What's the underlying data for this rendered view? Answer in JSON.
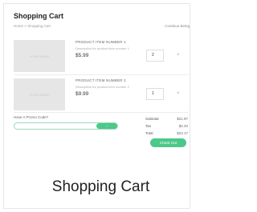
{
  "cart": {
    "title": "Shopping Cart",
    "breadcrumb": "Home > Shopping Cart",
    "continue_label": "Continue Being",
    "items": [
      {
        "name": "PRODUCT ITEM NUMBER 1",
        "description": "Description for product item number 1",
        "price": "$5.99",
        "quantity": "2",
        "image_label": "YOUR IMAGE",
        "remove_symbol": "×"
      },
      {
        "name": "PRODUCT ITEM NUMBER 2",
        "description": "Description for product item number 2",
        "price": "$9.99",
        "quantity": "1",
        "image_label": "YOUR IMAGE",
        "remove_symbol": "×"
      }
    ],
    "promo": {
      "label": "Have A Promo Code?",
      "input_value": "",
      "button_symbol": "→"
    },
    "totals": {
      "subtotal_label": "Subtotal",
      "subtotal_value": "$21.97",
      "tax_label": "Tax",
      "tax_value": "$2.20",
      "total_label": "Total",
      "total_value": "$24.17"
    },
    "checkout_label": "Check Out"
  },
  "caption": "Shopping Cart",
  "colors": {
    "accent": "#4cc88a",
    "thumb_bg": "#e6e6e6"
  }
}
